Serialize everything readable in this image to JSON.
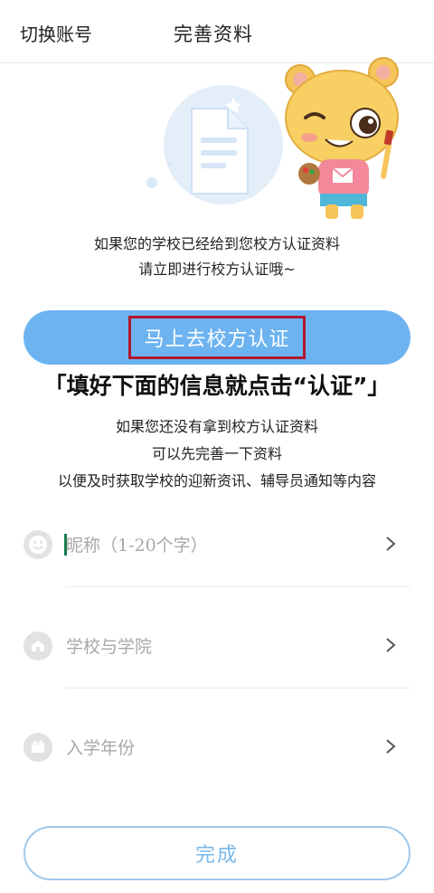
{
  "header": {
    "switch_account": "切换账号",
    "title": "完善资料"
  },
  "intro": {
    "line1": "如果您的学校已经给到您校方认证资料",
    "line2": "请立即进行校方认证哦~"
  },
  "verify_button": {
    "label": "马上去校方认证"
  },
  "banner": "「填好下面的信息就点击“认证”」",
  "notice": {
    "line1": "如果您还没有拿到校方认证资料",
    "line2": "可以先完善一下资料",
    "line3": "以便及时获取学校的迎新资讯、辅导员通知等内容"
  },
  "form": {
    "nickname_placeholder": "昵称（1-20个字）",
    "school_label": "学校与学院",
    "year_label": "入学年份"
  },
  "done_button": {
    "label": "完成"
  },
  "icons": {
    "nickname": "smiley-icon",
    "school": "school-building-icon",
    "year": "calendar-icon",
    "chevron": "chevron-right-icon"
  },
  "colors": {
    "primary_button": "#6cb3f0",
    "highlight_border": "#b3172e",
    "done_border": "#9fc9ec",
    "done_text": "#7ab8ea",
    "placeholder": "#a8a8a8"
  }
}
